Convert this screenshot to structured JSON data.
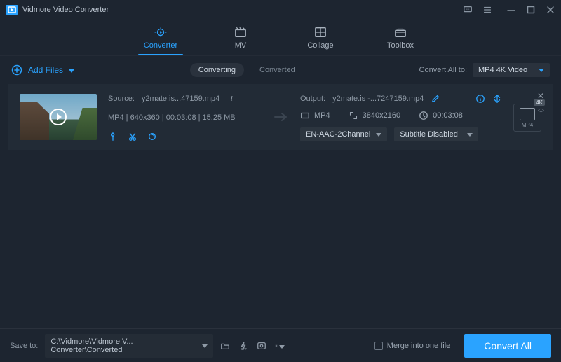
{
  "app": {
    "title": "Vidmore Video Converter"
  },
  "tabs": {
    "converter": "Converter",
    "mv": "MV",
    "collage": "Collage",
    "toolbox": "Toolbox"
  },
  "toolbar": {
    "add_files": "Add Files",
    "converting": "Converting",
    "converted": "Converted",
    "convert_all_to": "Convert All to:",
    "convert_all_value": "MP4 4K Video"
  },
  "item": {
    "source_label": "Source:",
    "source_file": "y2mate.is...47159.mp4",
    "source_meta": "MP4 | 640x360 | 00:03:08 | 15.25 MB",
    "output_label": "Output:",
    "output_file": "y2mate.is -...7247159.mp4",
    "out_format": "MP4",
    "out_resolution": "3840x2160",
    "out_duration": "00:03:08",
    "audio_select": "EN-AAC-2Channel",
    "subtitle_select": "Subtitle Disabled",
    "fmt_badge": "4K",
    "fmt_label": "MP4"
  },
  "footer": {
    "save_to_label": "Save to:",
    "save_path": "C:\\Vidmore\\Vidmore V... Converter\\Converted",
    "merge_label": "Merge into one file",
    "convert_all_btn": "Convert All"
  }
}
